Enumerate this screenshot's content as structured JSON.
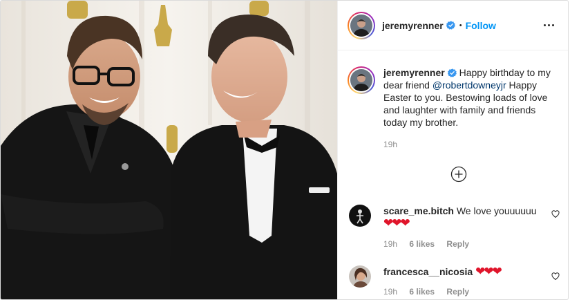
{
  "post": {
    "username": "jeremyrenner",
    "verified": true,
    "follow_label": "Follow",
    "dot": "•"
  },
  "caption": {
    "username": "jeremyrenner",
    "text_before": "Happy birthday to my dear friend ",
    "mention": "@robertdowneyjr",
    "text_after": " Happy Easter to you. Bestowing loads of love and laughter with family and friends today my brother.",
    "time": "19h"
  },
  "comments": [
    {
      "username": "scare_me.bitch",
      "text": "We love youuuuuu",
      "emoji": "❤❤❤",
      "time": "19h",
      "likes": "6 likes",
      "reply": "Reply"
    },
    {
      "username": "francesca__nicosia",
      "text": "",
      "emoji": "❤❤❤",
      "time": "19h",
      "likes": "6 likes",
      "reply": "Reply"
    }
  ],
  "colors": {
    "link": "#0095f6",
    "mention": "#00376b",
    "muted": "#8e8e8e",
    "heart": "#e0152b"
  },
  "icons": {
    "header_menu": "more-horizontal-icon",
    "load_more": "plus-circle-icon",
    "like": "heart-outline-icon",
    "badge": "verified-badge-icon"
  }
}
